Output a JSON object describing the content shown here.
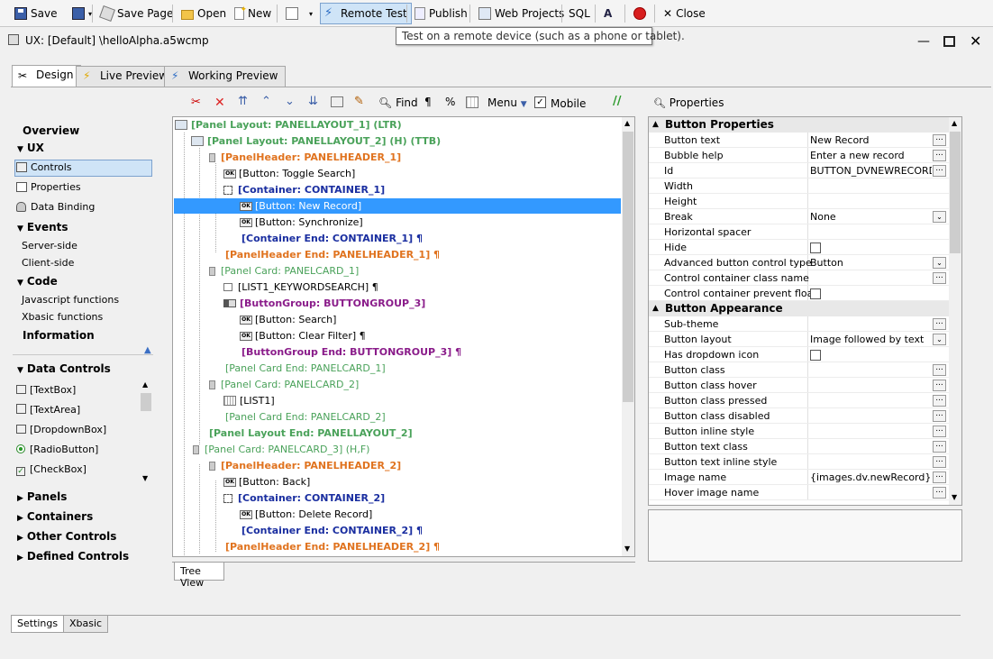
{
  "toolbar": {
    "save": "Save",
    "save_page": "Save Page",
    "open": "Open",
    "new": "New",
    "remote_test": "Remote Test",
    "publish": "Publish",
    "web_projects": "Web Projects",
    "sql": "SQL",
    "close": "Close"
  },
  "tooltip": "Test on a remote device (such as a phone or tablet).",
  "window": {
    "title": "UX: [Default] \\helloAlpha.a5wcmp"
  },
  "tabs": [
    "Design",
    "Live Preview",
    "Working Preview"
  ],
  "tree_toolbar": {
    "find": "Find",
    "menu": "Menu",
    "mobile": "Mobile"
  },
  "left_nav": {
    "overview": "Overview",
    "ux": "UX",
    "controls": "Controls",
    "properties": "Properties",
    "data_binding": "Data Binding",
    "events": "Events",
    "server_side": "Server-side",
    "client_side": "Client-side",
    "code": "Code",
    "javascript_functions": "Javascript functions",
    "xbasic_functions": "Xbasic functions",
    "information": "Information",
    "data_controls": "Data Controls",
    "data_control_items": [
      "[TextBox]",
      "[TextArea]",
      "[DropdownBox]",
      "[RadioButton]",
      "[CheckBox]"
    ],
    "panels": "Panels",
    "containers": "Containers",
    "other_controls": "Other Controls",
    "defined_controls": "Defined Controls"
  },
  "tree": [
    {
      "text": "[Panel Layout: PANELLAYOUT_1] (LTR)"
    },
    {
      "text": "[Panel Layout: PANELLAYOUT_2]  (H)  (TTB)"
    },
    {
      "text": "[PanelHeader: PANELHEADER_1]"
    },
    {
      "text": "[Button: Toggle Search]"
    },
    {
      "text": "[Container: CONTAINER_1]"
    },
    {
      "text": "[Button: New Record]"
    },
    {
      "text": "[Button: Synchronize]"
    },
    {
      "text": "[Container End: CONTAINER_1] ¶"
    },
    {
      "text": "[PanelHeader End: PANELHEADER_1] ¶"
    },
    {
      "text": "[Panel Card: PANELCARD_1]"
    },
    {
      "text": "[LIST1_KEYWORDSEARCH] ¶"
    },
    {
      "text": "[ButtonGroup: BUTTONGROUP_3]"
    },
    {
      "text": "[Button: Search]"
    },
    {
      "text": "[Button: Clear Filter] ¶"
    },
    {
      "text": "[ButtonGroup End: BUTTONGROUP_3] ¶"
    },
    {
      "text": "[Panel Card End: PANELCARD_1]"
    },
    {
      "text": "[Panel Card: PANELCARD_2]"
    },
    {
      "text": "[LIST1]"
    },
    {
      "text": "[Panel Card End: PANELCARD_2]"
    },
    {
      "text": "[Panel Layout End: PANELLAYOUT_2]"
    },
    {
      "text": "[Panel Card: PANELCARD_3]  (H,F)"
    },
    {
      "text": "[PanelHeader: PANELHEADER_2]"
    },
    {
      "text": "[Button: Back]"
    },
    {
      "text": "[Container: CONTAINER_2]"
    },
    {
      "text": "[Button: Delete Record]"
    },
    {
      "text": "[Container End: CONTAINER_2] ¶"
    },
    {
      "text": "[PanelHeader End: PANELHEADER_2] ¶"
    }
  ],
  "tree_view_tab": "Tree View",
  "properties": {
    "title": "Properties",
    "section1": "Button Properties",
    "rows1": [
      {
        "name": "Button text",
        "value": "New Record"
      },
      {
        "name": "Bubble help",
        "value": "Enter a new record"
      },
      {
        "name": "Id",
        "value": "BUTTON_DVNEWRECORD"
      },
      {
        "name": "Width",
        "value": ""
      },
      {
        "name": "Height",
        "value": ""
      },
      {
        "name": "Break",
        "value": "None"
      },
      {
        "name": "Horizontal spacer",
        "value": ""
      },
      {
        "name": "Hide",
        "value": ""
      },
      {
        "name": "Advanced button control type",
        "value": "Button"
      },
      {
        "name": "Control container class name",
        "value": ""
      },
      {
        "name": "Control container prevent float",
        "value": ""
      }
    ],
    "section2": "Button Appearance",
    "rows2": [
      {
        "name": "Sub-theme",
        "value": ""
      },
      {
        "name": "Button layout",
        "value": "Image followed by text"
      },
      {
        "name": "Has dropdown icon",
        "value": ""
      },
      {
        "name": "Button class",
        "value": ""
      },
      {
        "name": "Button class hover",
        "value": ""
      },
      {
        "name": "Button class pressed",
        "value": ""
      },
      {
        "name": "Button class disabled",
        "value": ""
      },
      {
        "name": "Button inline style",
        "value": ""
      },
      {
        "name": "Button text class",
        "value": ""
      },
      {
        "name": "Button text inline style",
        "value": ""
      },
      {
        "name": "Image name",
        "value": "{images.dv.newRecord}"
      },
      {
        "name": "Hover image name",
        "value": ""
      }
    ]
  },
  "bottom_tabs": [
    "Settings",
    "Xbasic"
  ]
}
